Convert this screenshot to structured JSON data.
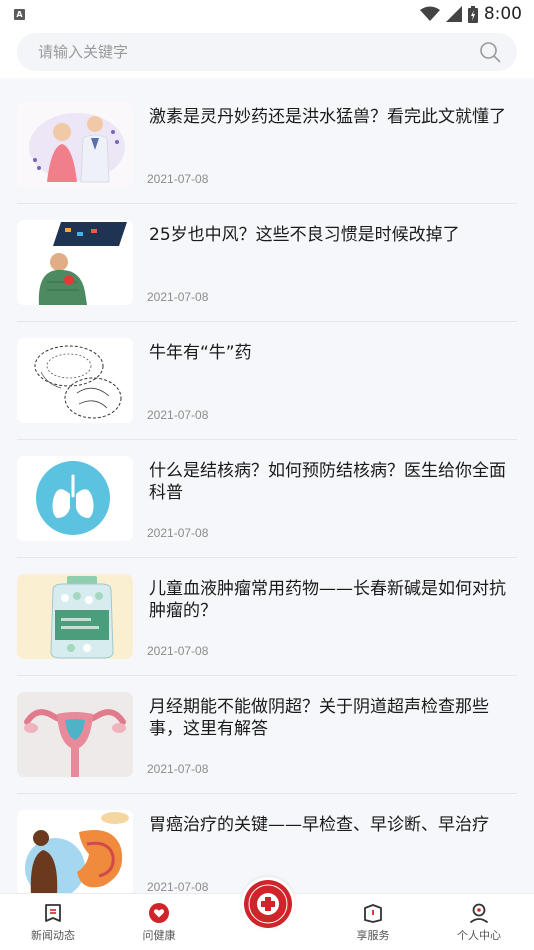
{
  "status_bar": {
    "time": "8:00",
    "sim_label": "A"
  },
  "search": {
    "placeholder": "请输入关键字"
  },
  "articles": [
    {
      "title": "激素是灵丹妙药还是洪水猛兽？看完此文就懂了",
      "date": "2021-07-08",
      "thumb_icon": "doctor-patient-illustration"
    },
    {
      "title": "25岁也中风？这些不良习惯是时候改掉了",
      "date": "2021-07-08",
      "thumb_icon": "man-phone-illustration"
    },
    {
      "title": "牛年有“牛”药",
      "date": "2021-07-08",
      "thumb_icon": "herb-sketch-illustration"
    },
    {
      "title": "什么是结核病？如何预防结核病？医生给你全面科普",
      "date": "2021-07-08",
      "thumb_icon": "lungs-icon"
    },
    {
      "title": "儿童血液肿瘤常用药物——长春新碱是如何对抗肿瘤的？",
      "date": "2021-07-08",
      "thumb_icon": "pill-bottle-illustration"
    },
    {
      "title": "月经期能不能做阴超？关于阴道超声检查那些事，这里有解答",
      "date": "2021-07-08",
      "thumb_icon": "uterus-illustration"
    },
    {
      "title": "胃癌治疗的关键——早检查、早诊断、早治疗",
      "date": "2021-07-08",
      "thumb_icon": "stomach-illustration"
    }
  ],
  "bottom_nav": {
    "items": [
      {
        "label": "新闻动态",
        "icon": "news-icon"
      },
      {
        "label": "问健康",
        "icon": "heart-icon"
      },
      {
        "label": "享服务",
        "icon": "service-icon"
      },
      {
        "label": "个人中心",
        "icon": "profile-icon"
      }
    ],
    "center_icon": "hospital-logo-icon"
  },
  "colors": {
    "accent": "#d0242b",
    "background": "#f6f7fa",
    "lung_circle": "#5bc2e0"
  }
}
